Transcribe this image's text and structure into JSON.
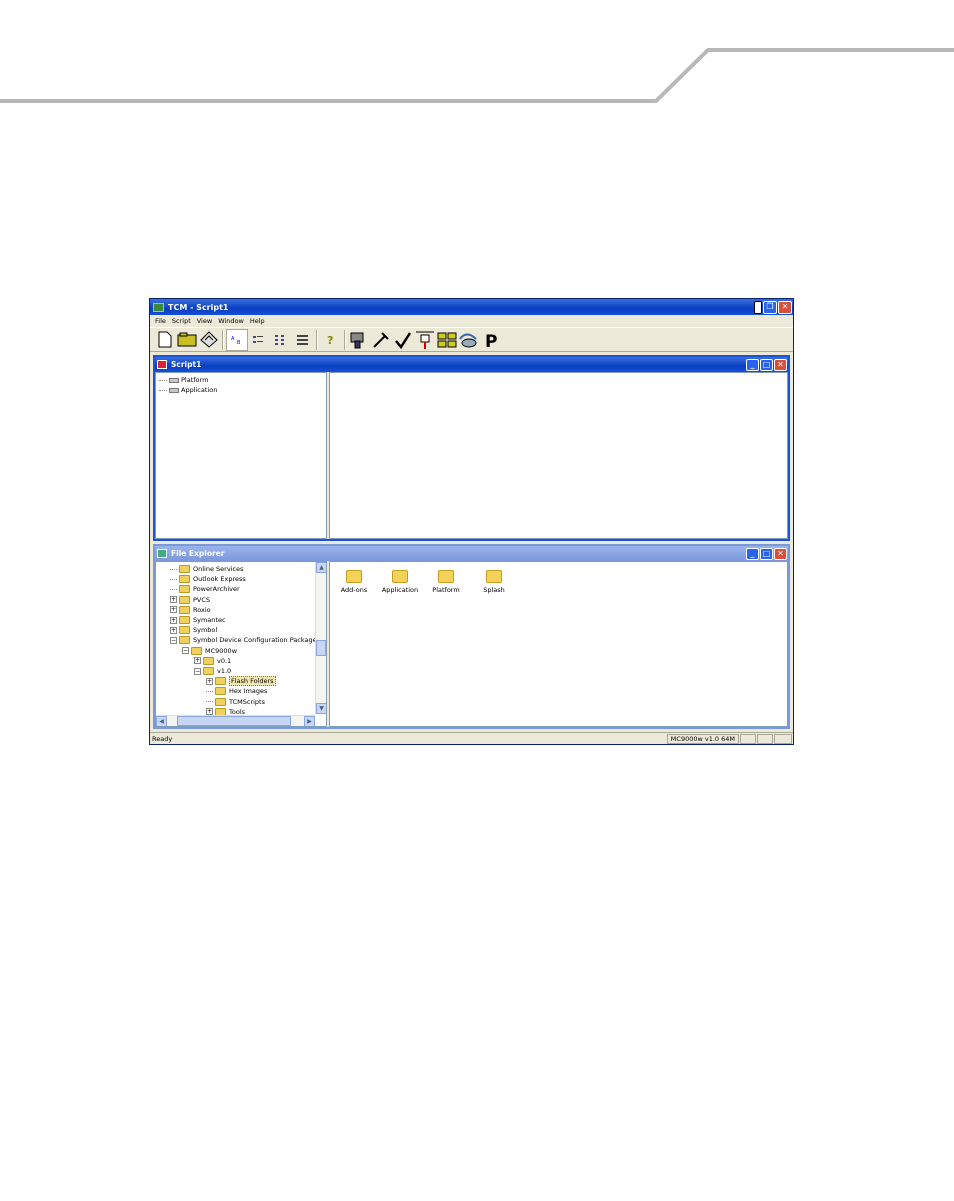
{
  "app": {
    "title": "TCM - Script1",
    "menu": [
      "File",
      "Script",
      "View",
      "Window",
      "Help"
    ],
    "toolbar_icons": [
      "new-icon",
      "open-icon",
      "save-icon",
      "view-large-icon",
      "view-small-icon",
      "view-list-icon",
      "view-details-icon",
      "help-icon",
      "build-icon",
      "tools-icon",
      "check-icon",
      "transfer-icon",
      "grid-icon",
      "connect-icon",
      "parking-icon"
    ]
  },
  "script_window": {
    "title": "Script1",
    "tree": [
      "Platform",
      "Application"
    ]
  },
  "explorer_window": {
    "title": "File Explorer",
    "tree": [
      {
        "label": "Online Services",
        "level": 1,
        "expander": ""
      },
      {
        "label": "Outlook Express",
        "level": 1,
        "expander": ""
      },
      {
        "label": "PowerArchiver",
        "level": 1,
        "expander": ""
      },
      {
        "label": "PVCS",
        "level": 1,
        "expander": "+"
      },
      {
        "label": "Roxio",
        "level": 1,
        "expander": "+"
      },
      {
        "label": "Symantec",
        "level": 1,
        "expander": "+"
      },
      {
        "label": "Symbol",
        "level": 1,
        "expander": "+"
      },
      {
        "label": "Symbol Device Configuration Packages",
        "level": 1,
        "expander": "−"
      },
      {
        "label": "MC9000w",
        "level": 2,
        "expander": "−"
      },
      {
        "label": "v0.1",
        "level": 3,
        "expander": "+"
      },
      {
        "label": "v1.0",
        "level": 3,
        "expander": "−"
      },
      {
        "label": "Flash Folders",
        "level": 4,
        "expander": "+",
        "selected": true
      },
      {
        "label": "Hex Images",
        "level": 4,
        "expander": ""
      },
      {
        "label": "TCMScripts",
        "level": 4,
        "expander": ""
      },
      {
        "label": "Tools",
        "level": 4,
        "expander": "+"
      }
    ],
    "files": [
      "Add-ons",
      "Application",
      "Platform",
      "Splash"
    ]
  },
  "status": {
    "left": "Ready",
    "right": "MC9000w v1.0 64M"
  },
  "colors": {
    "titlebar": "#0a3fc0",
    "window_bg": "#ece9d8",
    "folder": "#f3d25a"
  }
}
